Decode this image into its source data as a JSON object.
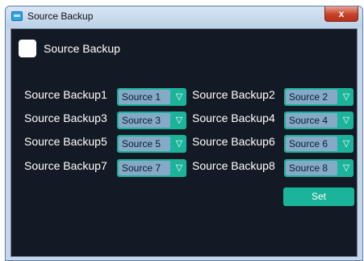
{
  "window": {
    "title": "Source Backup",
    "close_label": "x"
  },
  "main_option": {
    "label": "Source Backup",
    "checked": false
  },
  "backups": [
    {
      "label": "Source Backup1",
      "value": "Source 1"
    },
    {
      "label": "Source Backup2",
      "value": "Source 2"
    },
    {
      "label": "Source Backup3",
      "value": "Source 3"
    },
    {
      "label": "Source Backup4",
      "value": "Source 4"
    },
    {
      "label": "Source Backup5",
      "value": "Source 5"
    },
    {
      "label": "Source Backup6",
      "value": "Source 6"
    },
    {
      "label": "Source Backup7",
      "value": "Source 7"
    },
    {
      "label": "Source Backup8",
      "value": "Source 8"
    }
  ],
  "dropdown_arrow": "▽",
  "set_label": "Set",
  "colors": {
    "background": "#141a25",
    "accent": "#1bb39a",
    "select_value_bg": "#84aac8"
  }
}
